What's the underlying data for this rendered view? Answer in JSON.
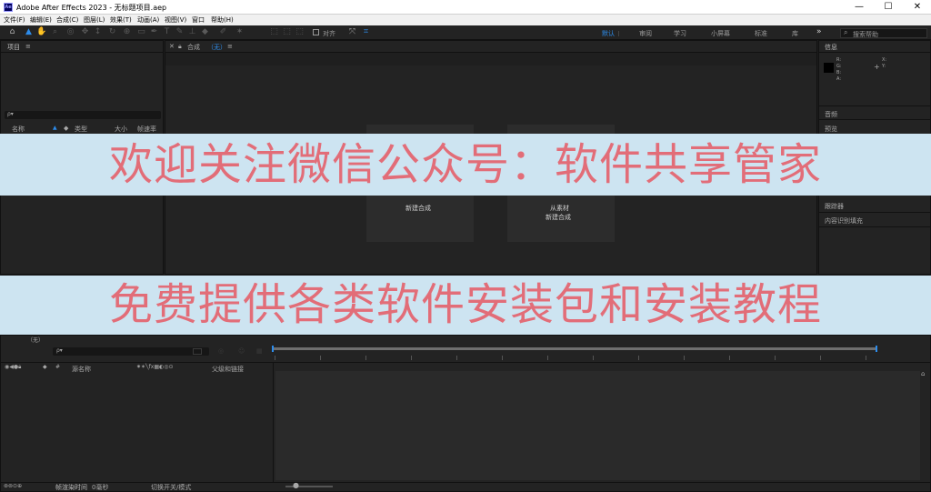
{
  "app": {
    "logo_text": "Ae",
    "title": "Adobe After Effects 2023 - 无标题项目.aep",
    "min": "—",
    "max": "☐",
    "close": "✕"
  },
  "menu": [
    "文件(F)",
    "编辑(E)",
    "合成(C)",
    "图层(L)",
    "效果(T)",
    "动画(A)",
    "视图(V)",
    "窗口",
    "帮助(H)"
  ],
  "toolbar": {
    "snap_label": "对齐",
    "workspaces": [
      "默认",
      "审阅",
      "学习",
      "小屏幕",
      "标准",
      "库"
    ],
    "more": "»",
    "search_placeholder": "搜索帮助"
  },
  "project_panel": {
    "title": "项目",
    "search_glyph": "ρ▾",
    "columns": [
      "名称",
      "类型",
      "大小",
      "帧速率"
    ]
  },
  "comp_panel": {
    "title": "合成",
    "comp_name": "（无）",
    "new_comp": "新建合成",
    "from_footage_1": "从素材",
    "from_footage_2": "新建合成"
  },
  "info_panel": {
    "title": "信息",
    "rgba": [
      "R:",
      "G:",
      "B:",
      "A:"
    ],
    "xy": [
      "X:",
      "Y:"
    ],
    "audio": "音频",
    "preview": "预览",
    "tracker": "跟踪器",
    "content_aware": "内容识别填充"
  },
  "timeline": {
    "title": "（无）",
    "search_glyph": "ρ▾",
    "col_source": "源名称",
    "col_parent": "父级和链接",
    "render_time": "帧渲染时间",
    "render_value": "0毫秒",
    "toggle_modes": "切换开关/模式"
  },
  "banners": {
    "top": "欢迎关注微信公众号：软件共享管家",
    "bottom": "免费提供各类软件安装包和安装教程"
  },
  "colors": {
    "banner_bg": "#cde4f1",
    "banner_text": "#e26d78",
    "accent_blue": "#2d8ceb"
  }
}
